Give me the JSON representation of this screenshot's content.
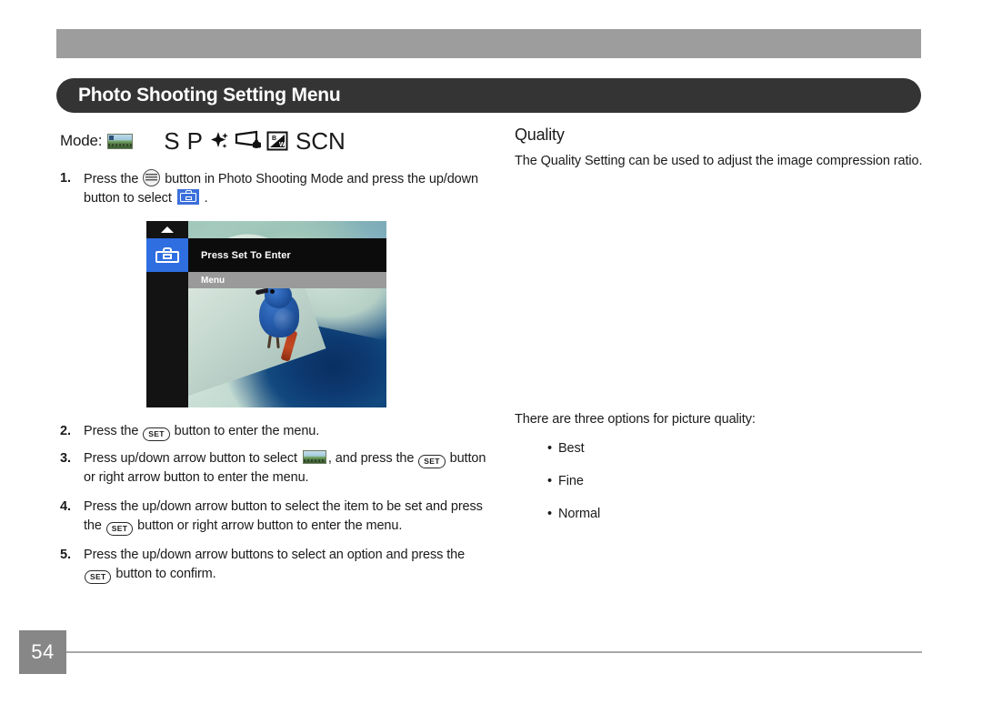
{
  "header": {
    "title": "Photo Shooting Setting Menu"
  },
  "mode": {
    "label": "Mode:",
    "icons": [
      "landscape-thumbnail",
      "S",
      "P",
      "sparkle-icon",
      "panorama-icon",
      "black-white-icon",
      "SCN"
    ],
    "letter_s": "S",
    "letter_p": "P",
    "scn": "SCN"
  },
  "steps": [
    {
      "num": "1.",
      "parts": [
        "Press the ",
        "func-menu-button",
        " button in Photo Shooting Mode and press the up/down button to select ",
        "toolbox-icon",
        " ."
      ],
      "text_a": "Press the ",
      "text_b": " button in Photo Shooting Mode and press the up/down button to select ",
      "text_c": " ."
    },
    {
      "num": "2.",
      "text_a": "Press the ",
      "text_b": " button to enter the menu."
    },
    {
      "num": "3.",
      "text_a": "Press up/down arrow button to select ",
      "text_b": ", and press the ",
      "text_c": " button or right arrow button to enter the menu."
    },
    {
      "num": "4.",
      "text_a": "Press the up/down arrow button to select the item to be set and press the ",
      "text_b": " button or right arrow button to enter the menu."
    },
    {
      "num": "5.",
      "text_a": "Press the up/down arrow buttons to select an option and press the ",
      "text_b": " button to confirm."
    }
  ],
  "camera_screen": {
    "banner_text": "Press Set To Enter",
    "subbar_text": "Menu",
    "sidebar_selected_icon": "toolbox-icon",
    "scroll_up_icon": "chevron-up-icon",
    "photo_subject": "blue bird on rock"
  },
  "quality_section": {
    "heading": "Quality",
    "description": "The Quality Setting can be used to adjust the image compression ratio.",
    "intro": "There are three options for picture quality:",
    "options": [
      "Best",
      "Fine",
      "Normal"
    ]
  },
  "footer": {
    "page_number": "54"
  },
  "colors": {
    "title_bar": "#343434",
    "top_bar": "#9d9d9d",
    "accent_blue": "#2f6ee0",
    "page_box": "#878787"
  }
}
